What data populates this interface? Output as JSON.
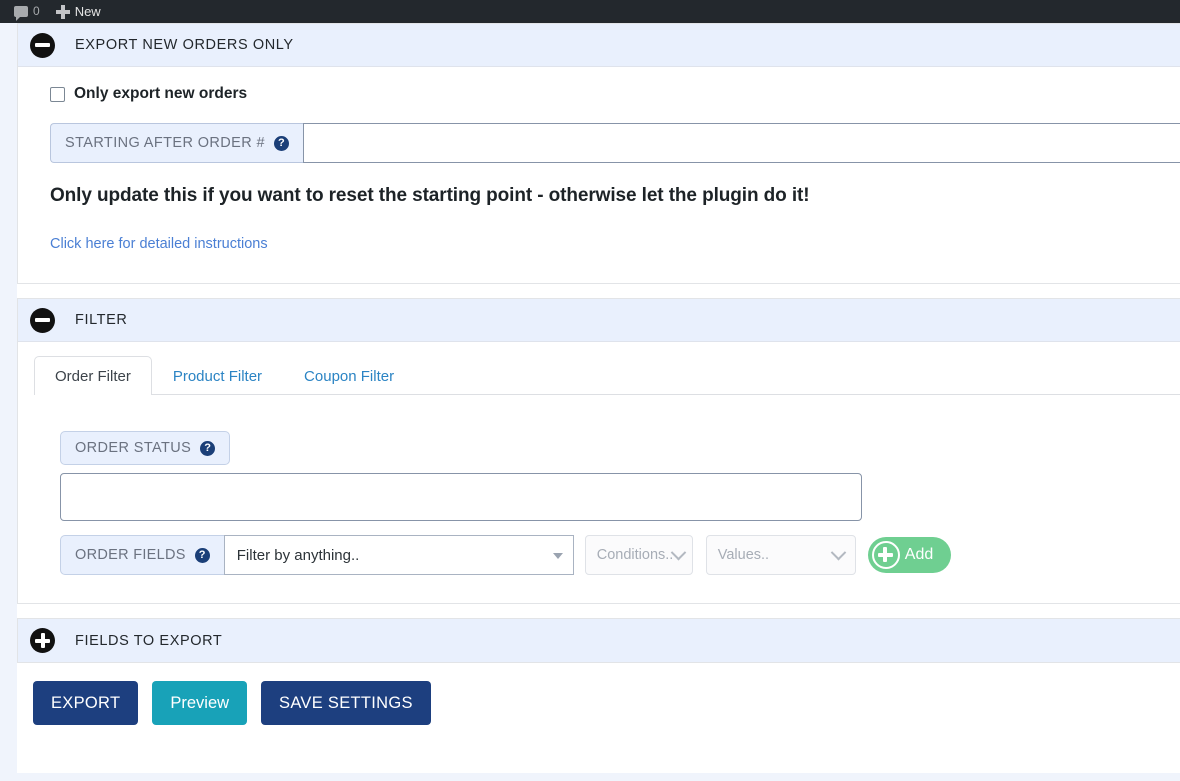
{
  "adminbar": {
    "comments_icon": "comment-bubble-icon",
    "comments_count": "0",
    "new_icon": "plus-icon",
    "new_label": "New"
  },
  "panels": {
    "export_new_orders": {
      "toggle_icon": "minus-circle-icon",
      "title": "EXPORT NEW ORDERS ONLY",
      "checkbox": {
        "checked": false,
        "label": "Only export new orders"
      },
      "starting_after": {
        "prefix_label": "STARTING AFTER ORDER #",
        "help_icon": "question-mark-icon",
        "value": "",
        "placeholder": ""
      },
      "note": "Only update this if you want to reset the starting point - otherwise let the plugin do it!",
      "link_text": "Click here for detailed instructions"
    },
    "filter": {
      "toggle_icon": "minus-circle-icon",
      "title": "FILTER",
      "tabs": [
        {
          "label": "Order Filter",
          "active": true
        },
        {
          "label": "Product Filter",
          "active": false
        },
        {
          "label": "Coupon Filter",
          "active": false
        }
      ],
      "order_status": {
        "label": "ORDER STATUS",
        "help_icon": "question-mark-icon",
        "value": ""
      },
      "order_fields": {
        "label": "ORDER FIELDS",
        "help_icon": "question-mark-icon",
        "select_value": "Filter by anything..",
        "caret_icon": "caret-down-icon",
        "conditions_placeholder": "Conditions..",
        "conditions_icon": "chevron-down-icon",
        "values_placeholder": "Values..",
        "values_icon": "chevron-down-icon",
        "add_icon": "plus-circle-icon",
        "add_label": "Add"
      }
    },
    "fields_to_export": {
      "toggle_icon": "plus-circle-icon",
      "title": "FIELDS TO EXPORT"
    }
  },
  "footer": {
    "export_label": "EXPORT",
    "preview_label": "Preview",
    "save_label": "SAVE SETTINGS"
  },
  "colors": {
    "adminbar_bg": "#23282d",
    "panel_head_bg": "#e9f0fd",
    "primary_navy": "#1d3f7f",
    "teal": "#18a2b8",
    "green": "#6fcf91",
    "link_blue": "#4a7fd4",
    "tab_blue": "#2b84c4"
  }
}
